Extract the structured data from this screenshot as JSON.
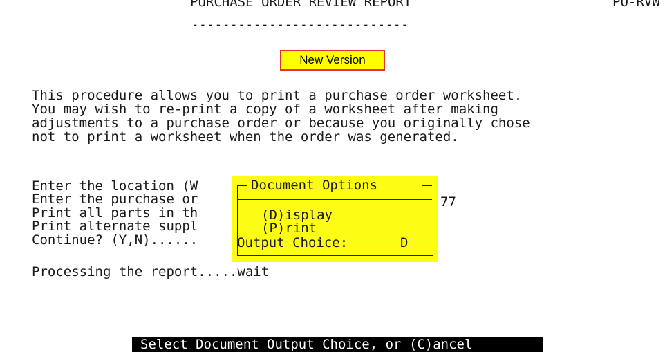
{
  "header": {
    "title": "PURCHASE ORDER REVIEW REPORT",
    "underline": "----------------------------",
    "program_id": "PO-RVW"
  },
  "badge": {
    "label": "New Version",
    "bg": "#ffff00",
    "border": "#e03030"
  },
  "info": {
    "lines": [
      "This procedure allows you to print a purchase order worksheet.",
      "You may wish to re-print a copy of a worksheet after making",
      "adjustments to a purchase order or because you originally chose",
      "not to print a worksheet when the order was generated."
    ]
  },
  "prompts": [
    "Enter the location (W",
    "Enter the purchase or",
    "Print all parts in th",
    "Print alternate suppl",
    "Continue? (Y,N)......"
  ],
  "po_number_tail": "77",
  "processing": "Processing the report.....wait",
  "dialog": {
    "title": "Document Options",
    "options": [
      "(D)isplay",
      "(P)rint"
    ],
    "output_label": "Output Choice:",
    "output_value": "D",
    "bg": "#fcfc14"
  },
  "status_bar": "Select Document Output Choice, or (C)ancel"
}
